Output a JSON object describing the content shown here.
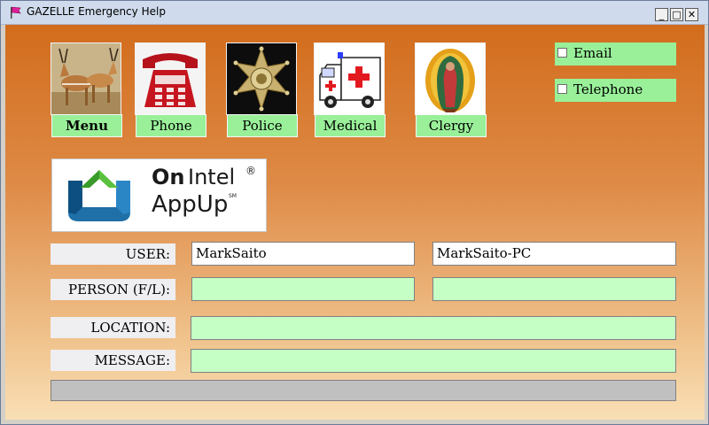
{
  "window": {
    "title": "GAZELLE Emergency Help",
    "app_icon": "pink-flag-icon"
  },
  "titlebar_buttons": {
    "minimize": "_",
    "maximize": "□",
    "close": "✕"
  },
  "tiles": [
    {
      "id": "menu",
      "label": "Menu",
      "icon": "gazelle-icon"
    },
    {
      "id": "phone",
      "label": "Phone",
      "icon": "phone-icon"
    },
    {
      "id": "police",
      "label": "Police",
      "icon": "police-badge-icon"
    },
    {
      "id": "medical",
      "label": "Medical",
      "icon": "ambulance-icon"
    },
    {
      "id": "clergy",
      "label": "Clergy",
      "icon": "clergy-icon"
    }
  ],
  "contact_methods": {
    "email": "Email",
    "telephone": "Telephone"
  },
  "logo": {
    "on": "On",
    "intel": "Intel",
    "registered": "®",
    "appup": "AppUp",
    "sm": "SM"
  },
  "form": {
    "user_label": "USER:",
    "user_value": "MarkSaito",
    "host_value": "MarkSaito-PC",
    "person_label": "PERSON (F/L):",
    "person_first": "",
    "person_last": "",
    "location_label": "LOCATION:",
    "location_value": "",
    "message_label": "MESSAGE:",
    "message_value": ""
  },
  "colors": {
    "label_green": "#99f099",
    "field_green": "#c6ffc6",
    "bg_top": "#d26c1c",
    "bg_bottom": "#f9dfb5"
  }
}
